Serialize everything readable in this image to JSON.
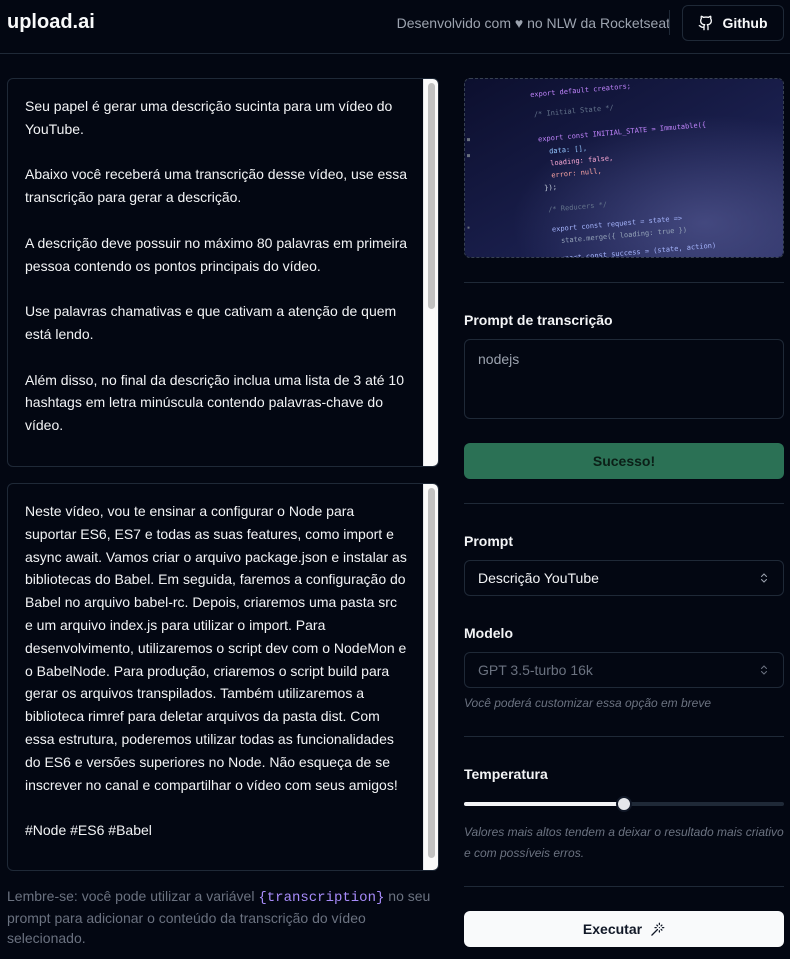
{
  "header": {
    "logo": "upload.ai",
    "credit_prefix": "Desenvolvido com",
    "credit_suffix": "no NLW da Rocketseat",
    "github_label": "Github"
  },
  "prompt_text": "Seu papel é gerar uma descrição sucinta para um vídeo do YouTube.\n\nAbaixo você receberá uma transcrição desse vídeo, use essa transcrição para gerar a descrição.\n\nA descrição deve possuir no máximo 80 palavras em primeira pessoa contendo os pontos principais do vídeo.\n\nUse palavras chamativas e que cativam a atenção de quem está lendo.\n\nAlém disso, no final da descrição inclua uma lista de 3 até 10 hashtags em letra minúscula contendo palavras-chave do vídeo.\n\nO retorno deve seguir o seguinte formato:",
  "result_text": "Neste vídeo, vou te ensinar a configurar o Node para suportar ES6, ES7 e todas as suas features, como import e async await. Vamos criar o arquivo package.json e instalar as bibliotecas do Babel. Em seguida, faremos a configuração do Babel no arquivo babel-rc. Depois, criaremos uma pasta src e um arquivo index.js para utilizar o import. Para desenvolvimento, utilizaremos o script dev com o NodeMon e o BabelNode. Para produção, criaremos o script build para gerar os arquivos transpilados. Também utilizaremos a biblioteca rimref para deletar arquivos da pasta dist. Com essa estrutura, poderemos utilizar todas as funcionalidades do ES6 e versões superiores no Node. Não esqueça de se inscrever no canal e compartilhar o vídeo com seus amigos!\n\n#Node #ES6 #Babel",
  "hint": {
    "prefix": "Lembre-se: você pode utilizar a variável",
    "variable": "{transcription}",
    "suffix": "no seu prompt para adicionar o conteúdo da transcrição do vídeo selecionado."
  },
  "sidebar": {
    "transcription_label": "Prompt de transcrição",
    "transcription_value": "nodejs",
    "success_label": "Sucesso!",
    "prompt_label": "Prompt",
    "prompt_value": "Descrição YouTube",
    "model_label": "Modelo",
    "model_value": "GPT 3.5-turbo 16k",
    "model_helper": "Você poderá customizar essa opção em breve",
    "temperature_label": "Temperatura",
    "temperature_value": 0.5,
    "temperature_helper": "Valores mais altos tendem a deixar o resultado mais criativo e com possíveis erros.",
    "run_label": "Executar"
  },
  "colors": {
    "background": "#030712",
    "success": "#2b7155",
    "accent_variable": "#a78bfa"
  },
  "icons": [
    "heart-icon",
    "github-icon",
    "chevrons-updown-icon",
    "wand-icon"
  ]
}
